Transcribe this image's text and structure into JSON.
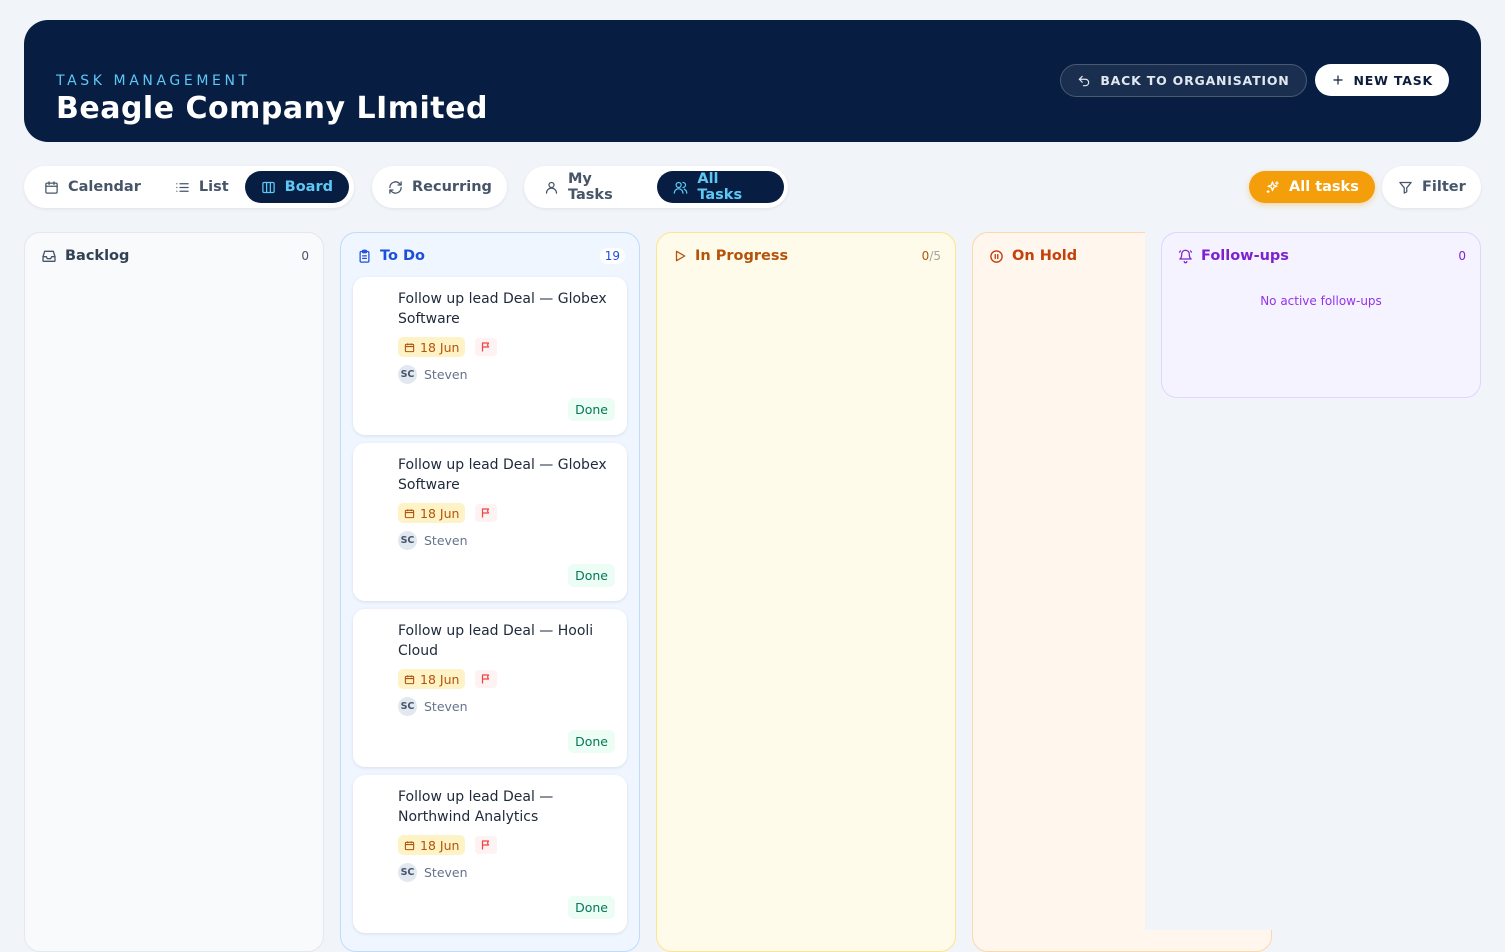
{
  "header": {
    "eyebrow": "TASK MANAGEMENT",
    "title": "Beagle Company LImited",
    "back_label": "BACK TO ORGANISATION",
    "new_task_label": "NEW TASK"
  },
  "toolbar": {
    "views": [
      {
        "label": "Calendar",
        "icon": "calendar-icon",
        "active": false
      },
      {
        "label": "List",
        "icon": "list-icon",
        "active": false
      },
      {
        "label": "Board",
        "icon": "board-icon",
        "active": true
      }
    ],
    "recurring_label": "Recurring",
    "scope": [
      {
        "label": "My Tasks",
        "icon": "user-icon",
        "active": false
      },
      {
        "label": "All Tasks",
        "icon": "users-icon",
        "active": true
      }
    ],
    "all_tasks_filter_label": "All tasks",
    "filter_label": "Filter"
  },
  "columns": {
    "backlog": {
      "title": "Backlog",
      "count": "0"
    },
    "todo": {
      "title": "To Do",
      "count": "19"
    },
    "in_progress": {
      "title": "In Progress",
      "count": "0",
      "limit": "/5"
    },
    "on_hold": {
      "title": "On Hold"
    },
    "followups": {
      "title": "Follow-ups",
      "count": "0",
      "empty_text": "No active follow-ups"
    }
  },
  "cards": [
    {
      "title": "Follow up lead Deal — Globex Software",
      "date": "18 Jun",
      "initials": "SC",
      "assignee": "Steven",
      "action": "Done"
    },
    {
      "title": "Follow up lead Deal — Globex Software",
      "date": "18 Jun",
      "initials": "SC",
      "assignee": "Steven",
      "action": "Done"
    },
    {
      "title": "Follow up lead Deal — Hooli Cloud",
      "date": "18 Jun",
      "initials": "SC",
      "assignee": "Steven",
      "action": "Done"
    },
    {
      "title": "Follow up lead Deal — Northwind Analytics",
      "date": "18 Jun",
      "initials": "SC",
      "assignee": "Steven",
      "action": "Done"
    }
  ],
  "colors": {
    "header_bg": "#071d41",
    "accent_cyan": "#5ec8f5",
    "accent_orange": "#f59e0b"
  }
}
